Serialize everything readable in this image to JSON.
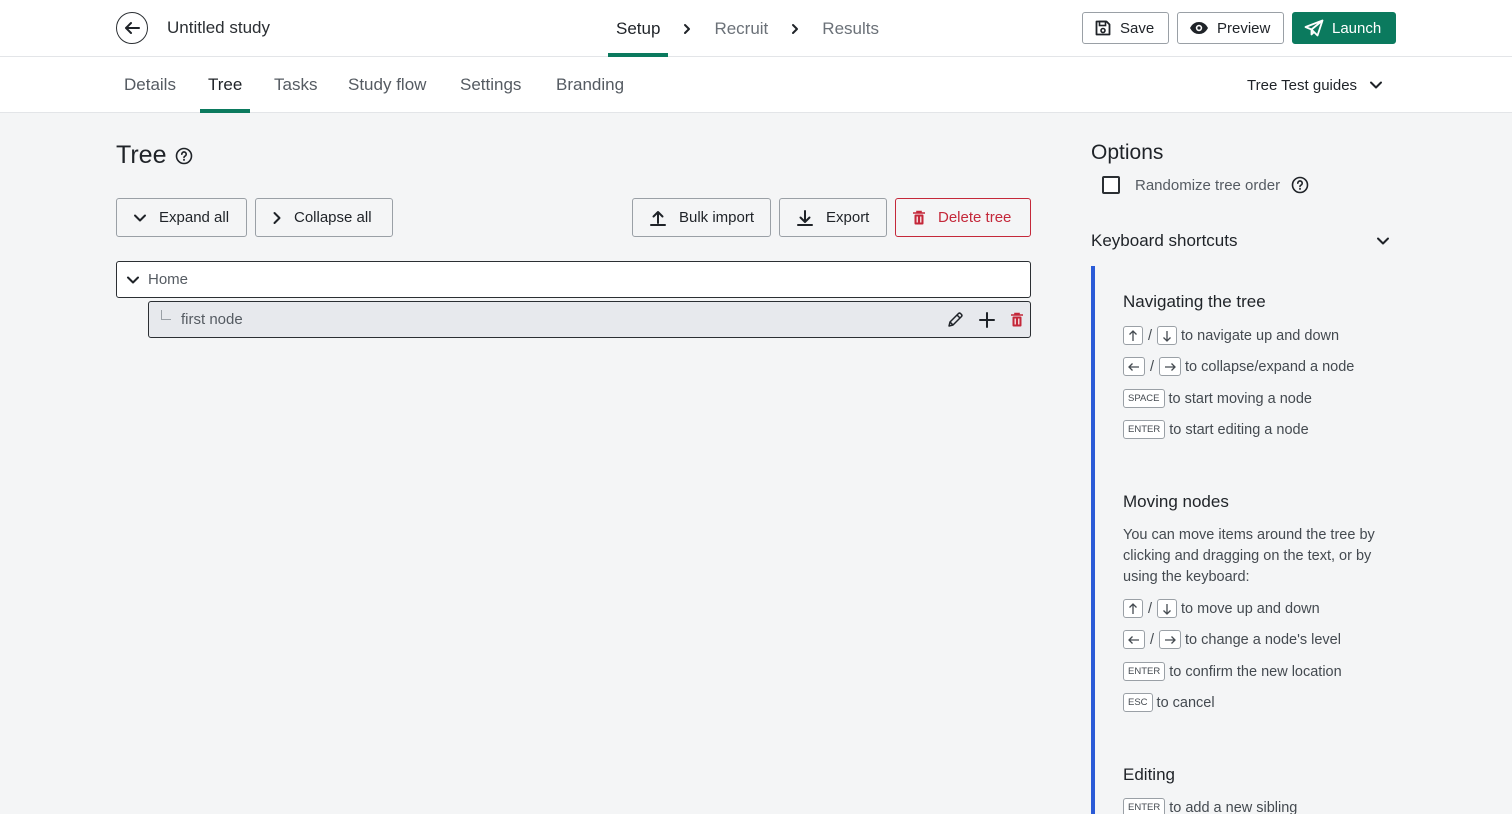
{
  "header": {
    "study_title": "Untitled study",
    "steps": [
      "Setup",
      "Recruit",
      "Results"
    ],
    "active_step": "Setup",
    "save_label": "Save",
    "preview_label": "Preview",
    "launch_label": "Launch"
  },
  "subnav": {
    "tabs": [
      "Details",
      "Tree",
      "Tasks",
      "Study flow",
      "Settings",
      "Branding"
    ],
    "active_tab": "Tree",
    "guides_label": "Tree Test guides"
  },
  "tree": {
    "title": "Tree",
    "expand_label": "Expand all",
    "collapse_label": "Collapse all",
    "bulk_import_label": "Bulk import",
    "export_label": "Export",
    "delete_label": "Delete tree",
    "nodes": [
      {
        "label": "Home",
        "expanded": true
      },
      {
        "label": "first node",
        "depth": 1
      }
    ]
  },
  "options": {
    "title": "Options",
    "randomize_label": "Randomize tree order",
    "randomize_checked": false,
    "shortcuts_label": "Keyboard shortcuts",
    "navigating": {
      "heading": "Navigating the tree",
      "row1": "to navigate up and down",
      "row2": "to collapse/expand a node",
      "row3": "to start moving a node",
      "row4": "to start editing a node"
    },
    "moving": {
      "heading": "Moving nodes",
      "description": "You can move items around the tree by clicking and dragging on the text, or by using the keyboard:",
      "row1": "to move up and down",
      "row2": "to change a node's level",
      "row3": "to confirm the new location",
      "row4": "to cancel"
    },
    "editing": {
      "heading": "Editing",
      "row1": "to add a new sibling"
    },
    "keys": {
      "space": "SPACE",
      "enter": "ENTER",
      "esc": "ESC",
      "slash": "/"
    }
  },
  "colors": {
    "brand_green": "#0b7a5e",
    "danger_red": "#c4283a",
    "shortcut_accent": "#2a5bd7"
  }
}
